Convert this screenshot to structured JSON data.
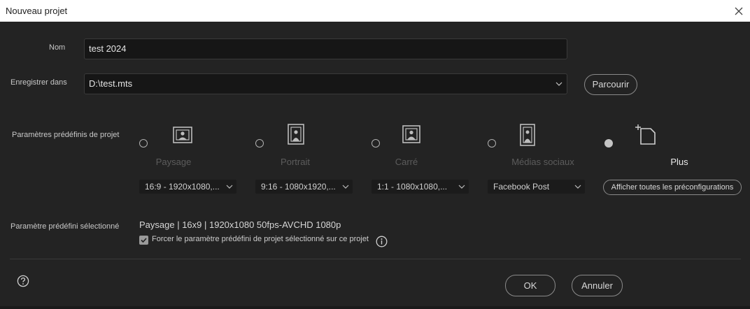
{
  "window": {
    "title": "Nouveau projet"
  },
  "form": {
    "name_label": "Nom",
    "name_value": "test 2024",
    "save_label": "Enregistrer dans",
    "save_value": "D:\\test.mts",
    "browse_label": "Parcourir"
  },
  "presets": {
    "section_label": "Paramètres prédéfinis de projet",
    "items": [
      {
        "name": "Paysage",
        "option": "16:9 - 1920x1080,...",
        "icon": "landscape-icon",
        "selected": false
      },
      {
        "name": "Portrait",
        "option": "9:16 - 1080x1920,...",
        "icon": "portrait-icon",
        "selected": false
      },
      {
        "name": "Carré",
        "option": "1:1 - 1080x1080,...",
        "icon": "square-icon",
        "selected": false
      },
      {
        "name": "Médias sociaux",
        "option": "Facebook Post",
        "icon": "social-media-icon",
        "selected": false
      },
      {
        "name": "Plus",
        "option": "Afficher toutes les préconfigurations",
        "icon": "crop-icon",
        "selected": true
      }
    ]
  },
  "selected_preset": {
    "label": "Paramètre prédéfini sélectionné",
    "value": "Paysage | 16x9 | 1920x1080 50fps-AVCHD 1080p",
    "force_label": "Forcer le paramètre prédéfini de projet sélectionné sur ce projet",
    "force_checked": true
  },
  "footer": {
    "ok_label": "OK",
    "cancel_label": "Annuler"
  }
}
